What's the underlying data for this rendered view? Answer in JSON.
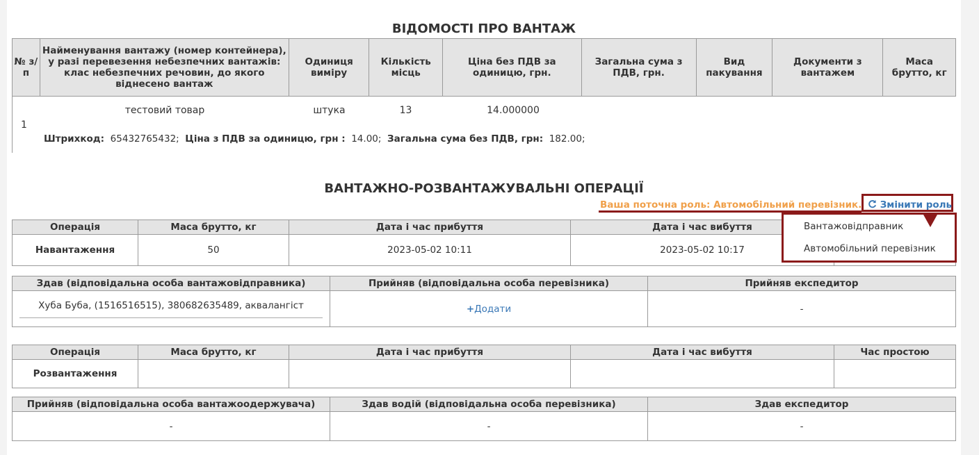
{
  "cargo": {
    "title": "ВІДОМОСТІ ПРО ВАНТАЖ",
    "headers": [
      "№ з/п",
      "Найменування вантажу (номер контейнера), у разі перевезення небезпечних вантажів: клас небезпечних речовин, до якого віднесено вантаж",
      "Одиниця виміру",
      "Кількість місць",
      "Ціна без ПДВ за одиницю, грн.",
      "Загальна сума з ПДВ, грн.",
      "Вид пакування",
      "Документи з вантажем",
      "Маса брутто, кг"
    ],
    "row": {
      "num": "1",
      "name": "тестовий товар",
      "unit": "штука",
      "qty": "13",
      "price": "14.000000",
      "barcode_label": "Штрихкод:",
      "barcode_value": "65432765432;",
      "price_vat_label": "Ціна з ПДВ за одиницю, грн :",
      "price_vat_value": "14.00;",
      "total_label": "Загальна сума без ПДВ, грн:",
      "total_value": "182.00;"
    }
  },
  "ops": {
    "title": "ВАНТАЖНО-РОЗВАНТАЖУВАЛЬНІ ОПЕРАЦІЇ",
    "current_role": "Ваша поточна роль: Автомобільний перевізник.",
    "change_role_label": "Змінити роль",
    "role_options": [
      "Вантажовідправник",
      "Автомобільний перевізник"
    ],
    "load": {
      "headers": [
        "Операція",
        "Маса брутто, кг",
        "Дата і час прибуття",
        "Дата і час вибуття"
      ],
      "operation": "Навантаження",
      "mass": "50",
      "arrival": "2023-05-02 10:11",
      "departure": "2023-05-02 10:17"
    },
    "load_persons": {
      "headers": [
        "Здав (відповідальна особа вантажовідправника)",
        "Прийняв (відповідальна особа перевізника)",
        "Прийняв експедитор"
      ],
      "handed": "Хуба Буба, (1516516515), 380682635489, аквалангіст",
      "add_label": "Додати",
      "forwarder": "-"
    },
    "unload": {
      "headers": [
        "Операція",
        "Маса брутто, кг",
        "Дата і час прибуття",
        "Дата і час вибуття",
        "Час простою"
      ],
      "operation": "Розвантаження"
    },
    "unload_persons": {
      "headers": [
        "Прийняв (відповідальна особа вантажоодержувача)",
        "Здав водій (відповідальна особа перевізника)",
        "Здав експедитор"
      ],
      "values": [
        "-",
        "-",
        "-"
      ]
    }
  },
  "colors": {
    "accent_orange": "#f0a04a",
    "link_blue": "#3a78b6",
    "highlight_red": "#8b1a1a"
  }
}
